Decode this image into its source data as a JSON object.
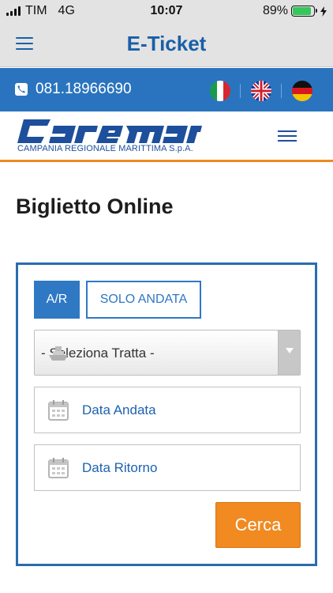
{
  "status_bar": {
    "carrier": "TIM",
    "network": "4G",
    "time": "10:07",
    "battery_percent": "89%",
    "battery_level": 0.89,
    "battery_color": "#34c759"
  },
  "app_header": {
    "title": "E-Ticket",
    "menu_icon": "hamburger-icon"
  },
  "contact_bar": {
    "phone_icon": "phone-icon",
    "phone": "081.18966690",
    "languages": [
      {
        "code": "it",
        "icon": "flag-italy-icon"
      },
      {
        "code": "en",
        "icon": "flag-uk-icon"
      },
      {
        "code": "de",
        "icon": "flag-germany-icon"
      }
    ],
    "background": "#2a74bf"
  },
  "logo": {
    "wordmark": "caremar",
    "subtitle": "CAMPANIA REGIONALE MARITTIMA S.p.A.",
    "brand_color": "#1d4f9c",
    "accent_color": "#f08a21"
  },
  "page": {
    "title": "Biglietto Online"
  },
  "booking_form": {
    "trip_types": [
      {
        "label": "A/R",
        "selected": true
      },
      {
        "label": "SOLO ANDATA",
        "selected": false
      }
    ],
    "route_select": {
      "value": "- Seleziona Tratta -",
      "icon": "ship-icon"
    },
    "departure_date": {
      "placeholder": "Data Andata",
      "icon": "calendar-icon"
    },
    "return_date": {
      "placeholder": "Data Ritorno",
      "icon": "calendar-icon"
    },
    "search_button": "Cerca",
    "search_color": "#f08a21"
  }
}
